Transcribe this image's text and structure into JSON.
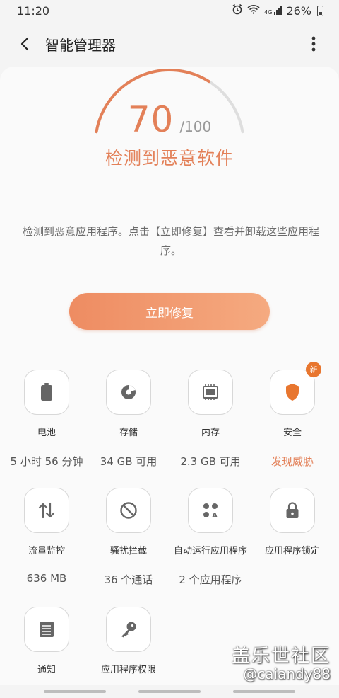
{
  "status_bar": {
    "time": "11:20",
    "icons": [
      "alarm-icon",
      "wifi-icon",
      "signal-icon"
    ],
    "signal_text": "4G",
    "battery": "26%"
  },
  "header": {
    "title": "智能管理器"
  },
  "score": {
    "value": "70",
    "max": "/100",
    "fraction": 0.7,
    "headline": "检测到恶意软件",
    "accent_color": "#e38058"
  },
  "description": "检测到恶意应用程序。点击【立即修复】查看并卸载这些应用程序。",
  "fix_button": {
    "label": "立即修复"
  },
  "tiles": [
    {
      "label": "电池",
      "value": "5 小时 56 分钟",
      "icon": "battery-icon"
    },
    {
      "label": "存储",
      "value": "34 GB 可用",
      "icon": "storage-pie-icon"
    },
    {
      "label": "内存",
      "value": "2.3 GB 可用",
      "icon": "memory-chip-icon"
    },
    {
      "label": "安全",
      "value": "发现威胁",
      "icon": "shield-icon",
      "badge": "新"
    },
    {
      "label": "流量监控",
      "value": "636 MB",
      "icon": "data-transfer-icon"
    },
    {
      "label": "骚扰拦截",
      "value": "36 个通话",
      "icon": "block-icon"
    },
    {
      "label": "自动运行应用程序",
      "value": "2 个应用程序",
      "icon": "auto-run-apps-icon"
    },
    {
      "label": "应用程序锁定",
      "value": "",
      "icon": "lock-icon"
    },
    {
      "label": "通知",
      "value": "",
      "icon": "notification-icon"
    },
    {
      "label": "应用程序权限",
      "value": "",
      "icon": "key-icon"
    }
  ],
  "watermark": {
    "title": "盖乐世社区",
    "handle": "@caiandy88"
  }
}
